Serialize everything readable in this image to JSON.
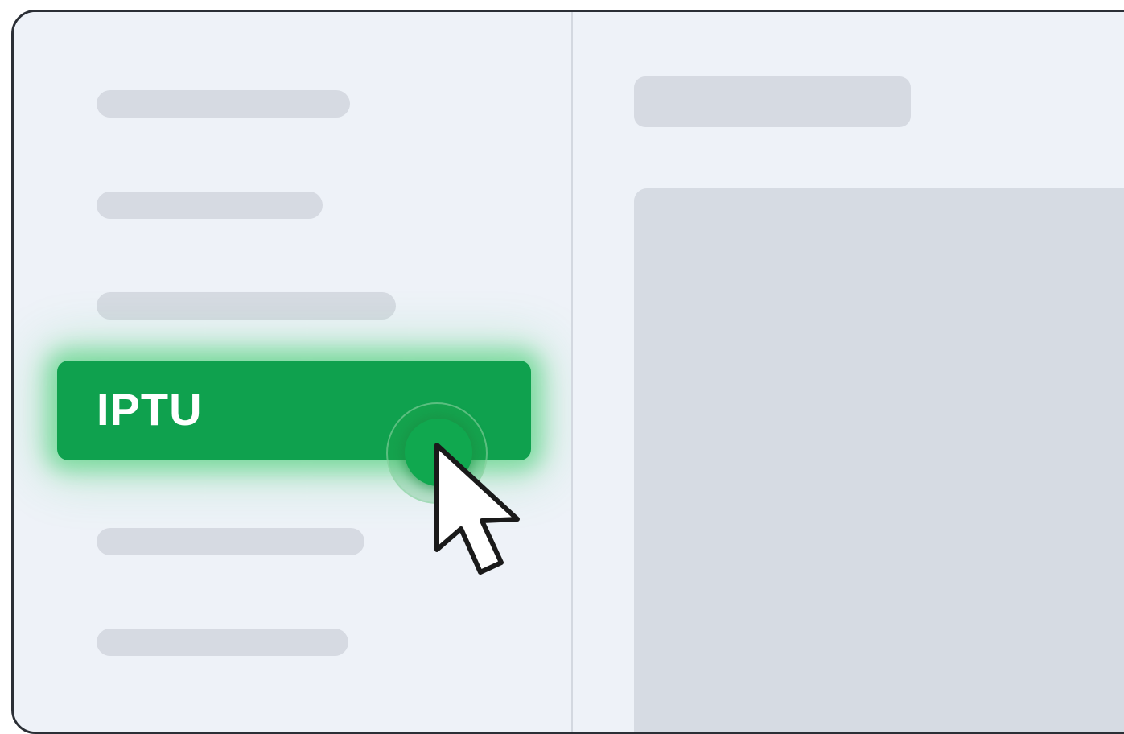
{
  "sidebar": {
    "active_item": {
      "label": "IPTU"
    }
  },
  "colors": {
    "active_green": "#0fa14e",
    "glow_green": "#28c85a",
    "background": "#eef2f8",
    "placeholder": "#d6dae2",
    "frame_border": "#2b2f36"
  },
  "icons": {
    "cursor": "mouse-pointer-icon"
  }
}
